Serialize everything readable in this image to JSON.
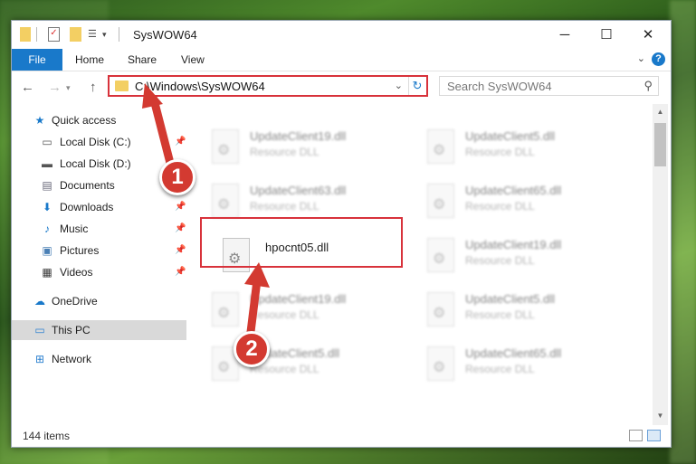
{
  "window": {
    "title": "SysWOW64",
    "minimize": "─",
    "maximize": "☐",
    "close": "✕"
  },
  "ribbon": {
    "file": "File",
    "home": "Home",
    "share": "Share",
    "view": "View",
    "help": "?"
  },
  "nav": {
    "back": "←",
    "forward": "→",
    "up": "↑",
    "address": "C:\\Windows\\SysWOW64",
    "search_placeholder": "Search SysWOW64"
  },
  "sidebar": {
    "quick_access": "Quick access",
    "items": [
      {
        "label": "Local Disk (C:)",
        "pinned": true
      },
      {
        "label": "Local Disk (D:)",
        "pinned": false
      },
      {
        "label": "Documents",
        "pinned": true
      },
      {
        "label": "Downloads",
        "pinned": true
      },
      {
        "label": "Music",
        "pinned": true
      },
      {
        "label": "Pictures",
        "pinned": true
      },
      {
        "label": "Videos",
        "pinned": true
      }
    ],
    "onedrive": "OneDrive",
    "this_pc": "This PC",
    "network": "Network"
  },
  "files": [
    {
      "name": "UpdateClient19.dll",
      "type": "Resource DLL"
    },
    {
      "name": "UpdateClient5.dll",
      "type": "Resource DLL"
    },
    {
      "name": "UpdateClient63.dll",
      "type": "Resource DLL"
    },
    {
      "name": "UpdateClient65.dll",
      "type": "Resource DLL"
    },
    {
      "name": "hpocnt05.dll",
      "type": ""
    },
    {
      "name": "UpdateClient19.dll",
      "type": "Resource DLL"
    },
    {
      "name": "UpdateClient19.dll",
      "type": "Resource DLL"
    },
    {
      "name": "UpdateClient5.dll",
      "type": "Resource DLL"
    },
    {
      "name": "UpdateClient5.dll",
      "type": "Resource DLL"
    },
    {
      "name": "UpdateClient65.dll",
      "type": "Resource DLL"
    }
  ],
  "status": {
    "count": "144 items"
  },
  "callouts": {
    "one": "1",
    "two": "2"
  },
  "colors": {
    "accent": "#1979ca",
    "highlight": "#d8323b",
    "callout": "#d33a31"
  }
}
